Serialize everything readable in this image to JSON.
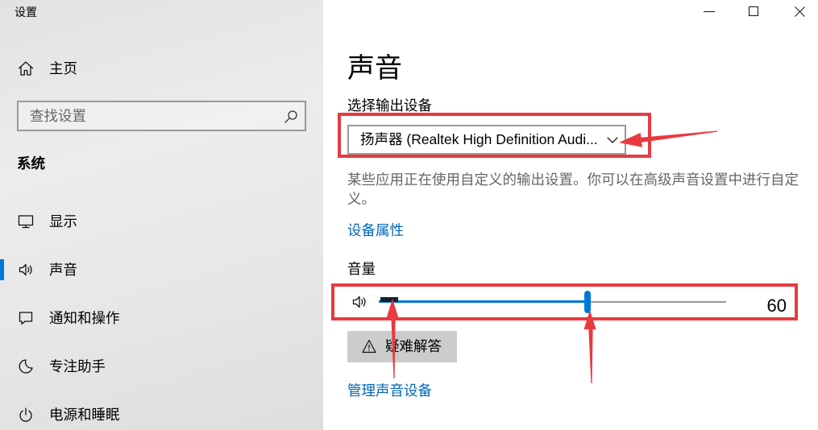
{
  "window": {
    "title": "设置",
    "controls": [
      "minimize-icon",
      "maximize-icon",
      "close-icon"
    ]
  },
  "sidebar": {
    "home": {
      "label": "主页",
      "icon": "home-icon"
    },
    "search": {
      "placeholder": "查找设置",
      "value": "",
      "icon": "search-icon"
    },
    "section_title": "系统",
    "items": [
      {
        "label": "显示",
        "icon": "monitor-icon",
        "selected": false
      },
      {
        "label": "声音",
        "icon": "speaker-icon",
        "selected": true
      },
      {
        "label": "通知和操作",
        "icon": "notification-icon",
        "selected": false
      },
      {
        "label": "专注助手",
        "icon": "moon-icon",
        "selected": false
      },
      {
        "label": "电源和睡眠",
        "icon": "power-icon",
        "selected": false
      }
    ]
  },
  "main": {
    "title": "声音",
    "output_device": {
      "label": "选择输出设备",
      "selected": "扬声器 (Realtek High Definition Audi...",
      "icon": "chevron-down-icon"
    },
    "custom_output_note": "某些应用正在使用自定义的输出设置。你可以在高级声音设置中进行自定义。",
    "device_properties_link": "设备属性",
    "volume": {
      "label": "音量",
      "value": 60,
      "icon": "speaker-icon"
    },
    "troubleshoot_button": {
      "label": "疑难解答",
      "icon": "warning-icon"
    },
    "manage_devices_link": "管理声音设备"
  },
  "colors": {
    "accent": "#0078d7",
    "link": "#0067b8",
    "annotation": "#e83a3f"
  }
}
